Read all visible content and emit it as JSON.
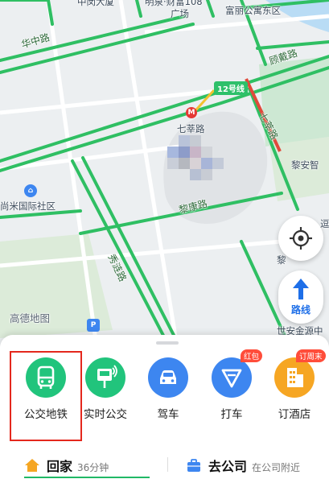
{
  "map": {
    "labels": {
      "building_top": "中闵大厦",
      "mall_top": "明泉·财富108",
      "mall_top_2": "广场",
      "apartment": "富丽公寓东区",
      "huazhong_road": "华中路",
      "gulong_road": "顾戴路",
      "qixin_road": "七莘路",
      "station": "七莘路",
      "li_an": "黎安智",
      "community": "尚米国际社区",
      "likang_road": "黎康路",
      "xiulian_road": "秀涟路",
      "watermark": "高德地图",
      "bottom_right": "世安金源中",
      "right_edge": "逗",
      "right_edge_2": "黎"
    },
    "metro_line": "12号线",
    "metro_icon": "M",
    "poi_icon": "home-pin-icon",
    "colors": {
      "background": "#eceff1",
      "road_green": "#2fbf63",
      "road_red": "#e04a3b",
      "park": "#cde8d3",
      "water": "#b9dcf5"
    }
  },
  "controls": {
    "locate_icon": "crosshair-icon",
    "route_label": "路线",
    "route_icon": "turn-arrow-icon"
  },
  "quick_actions": [
    {
      "label": "公交地铁",
      "icon": "bus-icon",
      "color": "#21c47c",
      "selected": true
    },
    {
      "label": "实时公交",
      "icon": "realtime-bus-icon",
      "color": "#21c47c"
    },
    {
      "label": "驾车",
      "icon": "car-icon",
      "color": "#3d86f0"
    },
    {
      "label": "打车",
      "icon": "taxi-icon",
      "color": "#3d86f0",
      "badge": "红包"
    },
    {
      "label": "订酒店",
      "icon": "hotel-icon",
      "color": "#f6a623",
      "badge": "订周末"
    }
  ],
  "favorites": {
    "home": {
      "title": "回家",
      "subtitle": "36分钟",
      "icon": "home-icon",
      "color": "#f5a623"
    },
    "work": {
      "title": "去公司",
      "subtitle": "在公司附近",
      "icon": "briefcase-icon",
      "color": "#3d86f0"
    }
  }
}
